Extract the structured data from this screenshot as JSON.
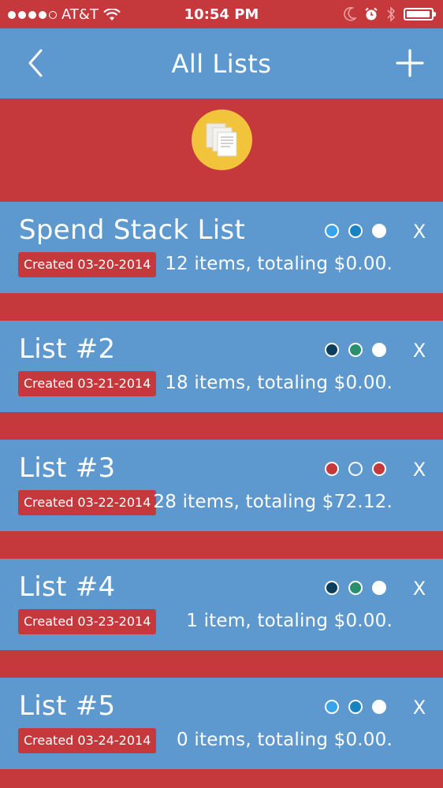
{
  "status_bar": {
    "carrier": "AT&T",
    "time": "10:54 PM",
    "signal_bars": 4,
    "signal_max": 5,
    "battery_level": 0.95
  },
  "nav": {
    "title": "All Lists",
    "back_icon": "chevron-left-icon",
    "add_icon": "plus-icon"
  },
  "colors": {
    "red": "#c5393c",
    "blue": "#5d98cf",
    "logo_yellow": "#f2c43b"
  },
  "lists": [
    {
      "name": "Spend Stack List",
      "created": "Created 03-20-2014",
      "summary": "12 items, totaling $0.00.",
      "dots": [
        "#37a3e8",
        "#1883c3",
        "#ffffff"
      ],
      "delete_label": "X"
    },
    {
      "name": "List #2",
      "created": "Created 03-21-2014",
      "summary": "18 items, totaling $0.00.",
      "dots": [
        "#0d3f5c",
        "#2a8f6f",
        "#ffffff"
      ],
      "delete_label": "X"
    },
    {
      "name": "List #3",
      "created": "Created 03-22-2014",
      "summary": "28 items, totaling $72.12.",
      "dots": [
        "#c5393c",
        "#5d98cf",
        "#c5393c"
      ],
      "delete_label": "X"
    },
    {
      "name": "List #4",
      "created": "Created 03-23-2014",
      "summary": "1 item, totaling $0.00.",
      "dots": [
        "#0d3f5c",
        "#2a8f6f",
        "#ffffff"
      ],
      "delete_label": "X"
    },
    {
      "name": "List #5",
      "created": "Created 03-24-2014",
      "summary": "0 items, totaling $0.00.",
      "dots": [
        "#37a3e8",
        "#1883c3",
        "#ffffff"
      ],
      "delete_label": "X"
    }
  ]
}
